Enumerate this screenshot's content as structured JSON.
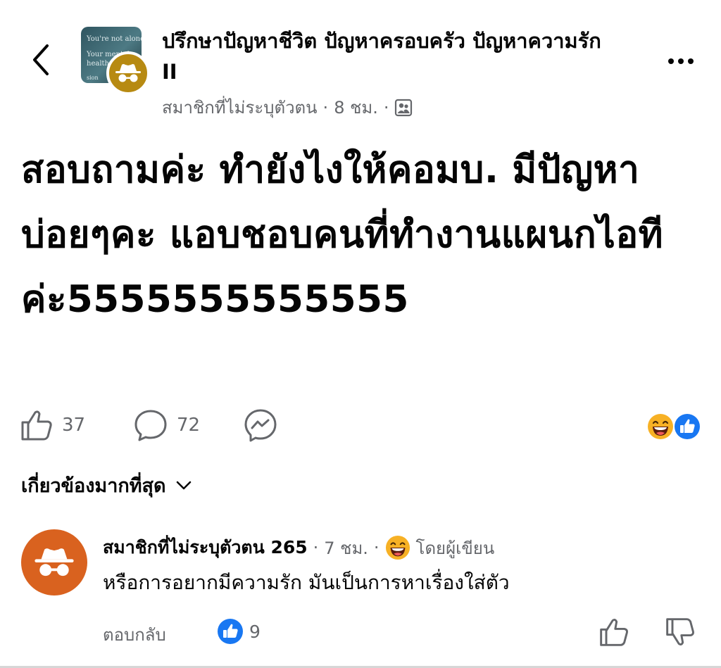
{
  "header": {
    "group_name": "ปรึกษาปัญหาชีวิต ปัญหาครอบครัว ปัญหาความรัก II",
    "thumbnail_text": [
      "You're not alone.",
      "Your mental",
      "health ma",
      "sion"
    ],
    "author": "สมาชิกที่ไม่ระบุตัวตน",
    "separator": "·",
    "time": "8 ชม.",
    "audience_icon": "group-audience-icon",
    "back_icon": "chevron-left-icon",
    "more_icon": "more-horizontal-icon"
  },
  "post": {
    "text": "สอบถามค่ะ ทำยังไงให้คอมบ. มีปัญหาบ่อยๆคะ แอบชอบคนที่ทำงานแผนกไอที ค่ะ5555555555555"
  },
  "actions": {
    "like_count": "37",
    "comment_count": "72",
    "like_icon": "thumbs-up-icon",
    "comment_icon": "comment-bubble-icon",
    "share_icon": "messenger-icon",
    "reactions": [
      "haha-emoji",
      "like-badge"
    ]
  },
  "sort": {
    "label": "เกี่ยวข้องมากที่สุด",
    "icon": "chevron-down-icon"
  },
  "comment": {
    "author": "สมาชิกที่ไม่ระบุตัวตน 265",
    "separator": "·",
    "time": "7 ชม.",
    "author_reaction_label": "โดยผู้เขียน",
    "text": "หรือการอยากมีความรัก มันเป็นการหาเรื่องใส่ตัว",
    "reply_label": "ตอบกลับ",
    "reaction_count": "9",
    "upvote_icon": "thumbs-up-outline-icon",
    "downvote_icon": "thumbs-down-outline-icon"
  },
  "colors": {
    "text_primary": "#050505",
    "text_secondary": "#65676b",
    "brand_blue": "#1877f2",
    "anon_avatar_gold": "#b78a12",
    "anon_avatar_orange": "#d9621f",
    "emoji_yellow": "#f7b125"
  }
}
